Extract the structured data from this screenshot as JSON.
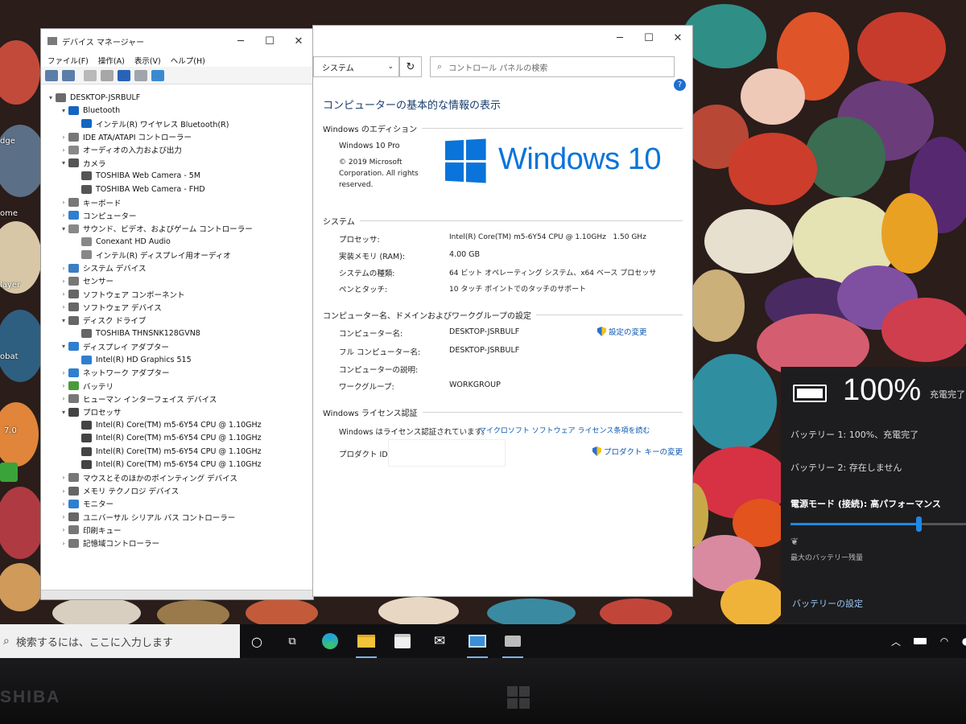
{
  "device_manager": {
    "title": "デバイス マネージャー",
    "menu": [
      "ファイル(F)",
      "操作(A)",
      "表示(V)",
      "ヘルプ(H)"
    ],
    "tree": [
      {
        "label": "DESKTOP-JSRBULF",
        "depth": 0,
        "arrow": "▾",
        "icon": "computer-icon",
        "color": "#6b6b6b"
      },
      {
        "label": "Bluetooth",
        "depth": 1,
        "arrow": "▾",
        "icon": "bluetooth-icon",
        "color": "#1565c0",
        "selected": true
      },
      {
        "label": "インテル(R) ワイヤレス Bluetooth(R)",
        "depth": 2,
        "arrow": "",
        "icon": "bluetooth-icon",
        "color": "#1565c0"
      },
      {
        "label": "IDE ATA/ATAPI コントローラー",
        "depth": 1,
        "arrow": "›",
        "icon": "ide-controller-icon",
        "color": "#777"
      },
      {
        "label": "オーディオの入力および出力",
        "depth": 1,
        "arrow": "›",
        "icon": "speaker-icon",
        "color": "#888"
      },
      {
        "label": "カメラ",
        "depth": 1,
        "arrow": "▾",
        "icon": "camera-icon",
        "color": "#555"
      },
      {
        "label": "TOSHIBA Web Camera - 5M",
        "depth": 2,
        "arrow": "",
        "icon": "camera-icon",
        "color": "#555"
      },
      {
        "label": "TOSHIBA Web Camera - FHD",
        "depth": 2,
        "arrow": "",
        "icon": "camera-icon",
        "color": "#555"
      },
      {
        "label": "キーボード",
        "depth": 1,
        "arrow": "›",
        "icon": "keyboard-icon",
        "color": "#777"
      },
      {
        "label": "コンピューター",
        "depth": 1,
        "arrow": "›",
        "icon": "monitor-icon",
        "color": "#2f7fcf"
      },
      {
        "label": "サウンド、ビデオ、およびゲーム コントローラー",
        "depth": 1,
        "arrow": "▾",
        "icon": "speaker-icon",
        "color": "#888"
      },
      {
        "label": "Conexant HD Audio",
        "depth": 2,
        "arrow": "",
        "icon": "speaker-icon",
        "color": "#888"
      },
      {
        "label": "インテル(R) ディスプレイ用オーディオ",
        "depth": 2,
        "arrow": "",
        "icon": "speaker-icon",
        "color": "#888"
      },
      {
        "label": "システム デバイス",
        "depth": 1,
        "arrow": "›",
        "icon": "system-device-icon",
        "color": "#3b7dc4"
      },
      {
        "label": "センサー",
        "depth": 1,
        "arrow": "›",
        "icon": "sensor-icon",
        "color": "#777"
      },
      {
        "label": "ソフトウェア コンポーネント",
        "depth": 1,
        "arrow": "›",
        "icon": "software-component-icon",
        "color": "#666"
      },
      {
        "label": "ソフトウェア デバイス",
        "depth": 1,
        "arrow": "›",
        "icon": "software-device-icon",
        "color": "#666"
      },
      {
        "label": "ディスク ドライブ",
        "depth": 1,
        "arrow": "▾",
        "icon": "disk-drive-icon",
        "color": "#666"
      },
      {
        "label": "TOSHIBA THNSNK128GVN8",
        "depth": 2,
        "arrow": "",
        "icon": "disk-drive-icon",
        "color": "#666"
      },
      {
        "label": "ディスプレイ アダプター",
        "depth": 1,
        "arrow": "▾",
        "icon": "display-adapter-icon",
        "color": "#2f7fcf"
      },
      {
        "label": "Intel(R) HD Graphics 515",
        "depth": 2,
        "arrow": "",
        "icon": "display-adapter-icon",
        "color": "#2f7fcf"
      },
      {
        "label": "ネットワーク アダプター",
        "depth": 1,
        "arrow": "›",
        "icon": "network-adapter-icon",
        "color": "#2f7fcf"
      },
      {
        "label": "バッテリ",
        "depth": 1,
        "arrow": "›",
        "icon": "battery-icon",
        "color": "#4a9a3a"
      },
      {
        "label": "ヒューマン インターフェイス デバイス",
        "depth": 1,
        "arrow": "›",
        "icon": "hid-icon",
        "color": "#777"
      },
      {
        "label": "プロセッサ",
        "depth": 1,
        "arrow": "▾",
        "icon": "processor-icon",
        "color": "#444"
      },
      {
        "label": "Intel(R) Core(TM) m5-6Y54 CPU @ 1.10GHz",
        "depth": 2,
        "arrow": "",
        "icon": "processor-icon",
        "color": "#444"
      },
      {
        "label": "Intel(R) Core(TM) m5-6Y54 CPU @ 1.10GHz",
        "depth": 2,
        "arrow": "",
        "icon": "processor-icon",
        "color": "#444"
      },
      {
        "label": "Intel(R) Core(TM) m5-6Y54 CPU @ 1.10GHz",
        "depth": 2,
        "arrow": "",
        "icon": "processor-icon",
        "color": "#444"
      },
      {
        "label": "Intel(R) Core(TM) m5-6Y54 CPU @ 1.10GHz",
        "depth": 2,
        "arrow": "",
        "icon": "processor-icon",
        "color": "#444"
      },
      {
        "label": "マウスとそのほかのポインティング デバイス",
        "depth": 1,
        "arrow": "›",
        "icon": "mouse-icon",
        "color": "#777"
      },
      {
        "label": "メモリ テクノロジ デバイス",
        "depth": 1,
        "arrow": "›",
        "icon": "memory-icon",
        "color": "#666"
      },
      {
        "label": "モニター",
        "depth": 1,
        "arrow": "›",
        "icon": "monitor-icon",
        "color": "#2f7fcf"
      },
      {
        "label": "ユニバーサル シリアル バス コントローラー",
        "depth": 1,
        "arrow": "›",
        "icon": "usb-icon",
        "color": "#666"
      },
      {
        "label": "印刷キュー",
        "depth": 1,
        "arrow": "›",
        "icon": "printer-icon",
        "color": "#777"
      },
      {
        "label": "記憶域コントローラー",
        "depth": 1,
        "arrow": "›",
        "icon": "storage-controller-icon",
        "color": "#777"
      }
    ]
  },
  "system": {
    "breadcrumb": "システム",
    "search_placeholder": "コントロール パネルの検索",
    "heading": "コンピューターの基本的な情報の表示",
    "edition_section": "Windows のエディション",
    "edition": "Windows 10 Pro",
    "copyright": "© 2019 Microsoft Corporation. All rights reserved.",
    "logo_text": "Windows 10",
    "system_section": "システム",
    "processor_label": "プロセッサ:",
    "processor_value": "Intel(R) Core(TM) m5-6Y54 CPU @ 1.10GHz   1.50 GHz",
    "ram_label": "実装メモリ (RAM):",
    "ram_value": "4.00 GB",
    "type_label": "システムの種類:",
    "type_value": "64 ビット オペレーティング システム、x64 ベース プロセッサ",
    "pen_label": "ペンとタッチ:",
    "pen_value": "10 タッチ ポイントでのタッチのサポート",
    "computer_section": "コンピューター名、ドメインおよびワークグループの設定",
    "name_label": "コンピューター名:",
    "name_value": "DESKTOP-JSRBULF",
    "change_settings": "設定の変更",
    "fullname_label": "フル コンピューター名:",
    "fullname_value": "DESKTOP-JSRBULF",
    "desc_label": "コンピューターの説明:",
    "workgroup_label": "ワークグループ:",
    "workgroup_value": "WORKGROUP",
    "license_section": "Windows ライセンス認証",
    "license_status": "Windows はライセンス認証されています。",
    "license_link": "マイクロソフト ソフトウェア ライセンス条項を読む",
    "product_id_label": "プロダクト ID:",
    "product_key_link": "プロダクト キーの変更"
  },
  "battery_flyout": {
    "percent": "100%",
    "status": "充電完了",
    "battery1": "バッテリー 1: 100%、充電完了",
    "battery2": "バッテリー 2: 存在しません",
    "power_mode": "電源モード (接続): 高パフォーマンス",
    "power_slider_level": 0.73,
    "min_label": "最大のバッテリー残量",
    "settings_link": "バッテリーの設定"
  },
  "taskbar": {
    "search_text": "検索するには、ここに入力します"
  },
  "desktop": {
    "fragments": [
      "dge",
      "ome",
      "layer",
      "obat",
      "7.0"
    ],
    "brand": "SHIBA"
  },
  "colors": {
    "accent": "#0078d7",
    "windows_blue": "#0a74da",
    "link": "#0b57b2"
  }
}
